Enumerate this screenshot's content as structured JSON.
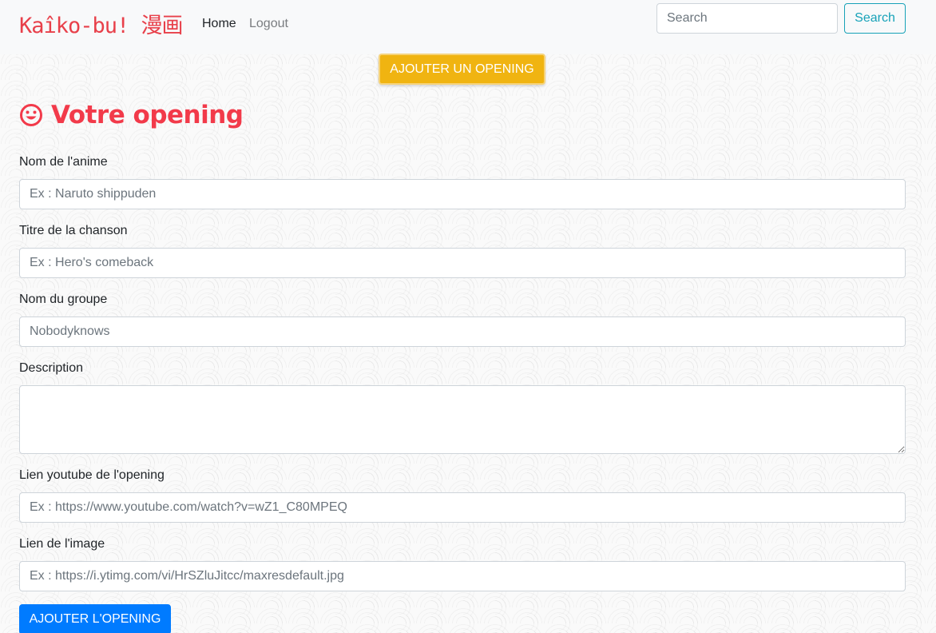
{
  "navbar": {
    "brand": "Kaîko-bu! 漫画",
    "home_label": "Home",
    "logout_label": "Logout",
    "search_placeholder": "Search",
    "search_button": "Search"
  },
  "add_opening_button": "AJOUTER UN OPENING",
  "page_title": "Votre opening",
  "form": {
    "anime_name": {
      "label": "Nom de l'anime",
      "placeholder": "Ex : Naruto shippuden",
      "value": ""
    },
    "song_title": {
      "label": "Titre de la chanson",
      "placeholder": "Ex : Hero's comeback",
      "value": ""
    },
    "group_name": {
      "label": "Nom du groupe",
      "placeholder": "Nobodyknows",
      "value": ""
    },
    "description": {
      "label": "Description",
      "value": ""
    },
    "youtube_link": {
      "label": "Lien youtube de l'opening",
      "placeholder": "Ex : https://www.youtube.com/watch?v=wZ1_C80MPEQ",
      "value": ""
    },
    "image_link": {
      "label": "Lien de l'image",
      "placeholder": "Ex : https://i.ytimg.com/vi/HrSZluJitcc/maxresdefault.jpg",
      "value": ""
    },
    "submit_label": "AJOUTER L'OPENING"
  },
  "colors": {
    "brand": "#e8404a",
    "title": "#f23a4a",
    "warning_button": "#f0b411",
    "primary_button": "#007bff",
    "search_button": "#17a2b8"
  },
  "icons": {
    "title_icon": "smiley-icon"
  }
}
